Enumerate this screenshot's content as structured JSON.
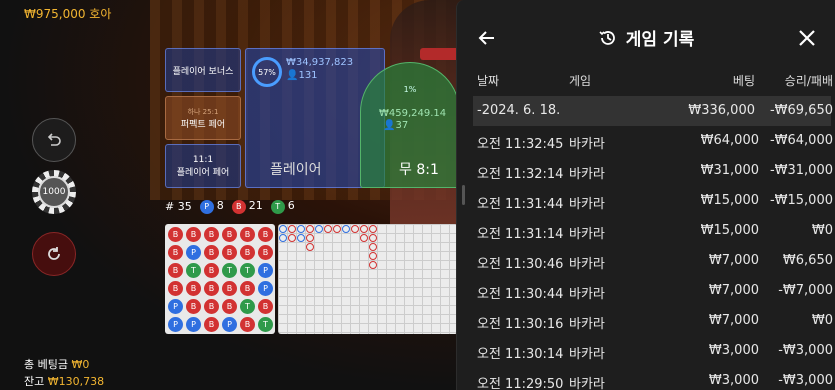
{
  "hud": {
    "chip_amount": "₩975,000 호아",
    "total_bet_label": "총 베팅금",
    "total_bet_value": "₩0",
    "balance_label": "잔고",
    "balance_value": "₩130,738",
    "chip_value": "1000"
  },
  "table": {
    "player_bonus": "플레이어 보너스",
    "perfect_pair_sub": "하나 25:1",
    "perfect_pair": "퍼펙트 페어",
    "pair_odds": "11:1",
    "pair_label": "플레이어 페어",
    "player_pct": "57%",
    "player_amount": "₩34,937,823",
    "player_count": "131",
    "player_label": "플레이어",
    "tie_pct": "1%",
    "tie_amount": "₩459,249.14",
    "tie_count": "37",
    "tie_label": "무 8:1"
  },
  "stats": {
    "rounds": "# 35",
    "p_letter": "P",
    "p_count": "8",
    "b_letter": "B",
    "b_count": "21",
    "t_letter": "T",
    "t_count": "6"
  },
  "bead_road": [
    "B",
    "B",
    "B",
    "B",
    "B",
    "B",
    "B",
    "P",
    "B",
    "B",
    "B",
    "B",
    "B",
    "T",
    "B",
    "T",
    "T",
    "P",
    "B",
    "B",
    "B",
    "B",
    "B",
    "P",
    "P",
    "B",
    "B",
    "B",
    "T",
    "B",
    "P",
    "P",
    "B",
    "P",
    "B",
    "T"
  ],
  "history": {
    "title": "게임 기록",
    "columns": {
      "date": "날짜",
      "game": "게임",
      "bet": "베팅",
      "result": "승리/패배"
    },
    "summary": {
      "date": "-2024. 6. 18.",
      "bet": "₩336,000",
      "result": "-₩69,650"
    },
    "rows": [
      {
        "date": "오전 11:32:45",
        "game": "바카라",
        "bet": "₩64,000",
        "result": "-₩64,000"
      },
      {
        "date": "오전 11:32:14",
        "game": "바카라",
        "bet": "₩31,000",
        "result": "-₩31,000"
      },
      {
        "date": "오전 11:31:44",
        "game": "바카라",
        "bet": "₩15,000",
        "result": "-₩15,000"
      },
      {
        "date": "오전 11:31:14",
        "game": "바카라",
        "bet": "₩15,000",
        "result": "₩0"
      },
      {
        "date": "오전 11:30:46",
        "game": "바카라",
        "bet": "₩7,000",
        "result": "₩6,650"
      },
      {
        "date": "오전 11:30:44",
        "game": "바카라",
        "bet": "₩7,000",
        "result": "-₩7,000"
      },
      {
        "date": "오전 11:30:16",
        "game": "바카라",
        "bet": "₩7,000",
        "result": "₩0"
      },
      {
        "date": "오전 11:30:14",
        "game": "바카라",
        "bet": "₩3,000",
        "result": "-₩3,000"
      },
      {
        "date": "오전 11:29:50",
        "game": "바카라",
        "bet": "₩3,000",
        "result": "-₩3,000"
      }
    ]
  }
}
